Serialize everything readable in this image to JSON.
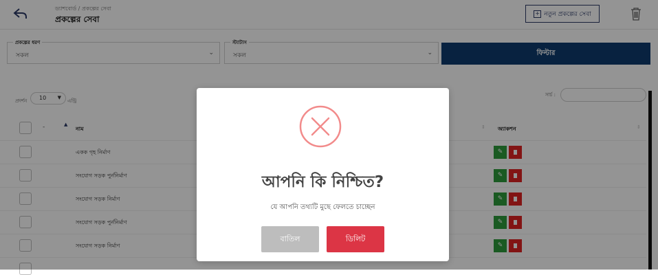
{
  "header": {
    "breadcrumb": "ড্যাশবোর্ড / প্রকল্পের সেবা",
    "title": "প্রকল্পের সেবা",
    "new_button_label": "নতুন প্রকল্পের সেবা"
  },
  "filters": {
    "type_label": "প্রকল্পের ধরণ",
    "type_value": "সকল",
    "status_label": "স্ট্যাটাস",
    "status_value": "সকল",
    "filter_button_label": "ফিল্টার"
  },
  "table_controls": {
    "show_label": "প্রদর্শন",
    "page_size": "10",
    "entries_label": "এন্ট্রি",
    "search_label": "সার্চ :"
  },
  "table": {
    "columns": [
      "নাম",
      "অ্যাকশন"
    ],
    "rows": [
      {
        "name": "একক গৃহ নির্মাণ"
      },
      {
        "name": "সংযোগ সড়ক পুর্ননির্মাণ"
      },
      {
        "name": "সংযোগ সড়ক নির্মাণ"
      },
      {
        "name": "সংযোগ সড়ক পুর্ননির্মাণ"
      },
      {
        "name": "সংযোগ সড়ক নির্মাণ"
      }
    ]
  },
  "modal": {
    "title": "আপনি কি নিশ্চিত?",
    "message": "যে আপনি তথ্যটি মুছে ফেলতে চাচ্ছেন",
    "cancel_label": "বাতিল",
    "confirm_label": "ডিলিট",
    "icon": "x-circle-icon"
  },
  "colors": {
    "primary": "#0e3c6e",
    "danger": "#dc3545",
    "success": "#2e9b3c",
    "modal_icon": "#f28b8b",
    "cancel": "#bdbdbd"
  }
}
